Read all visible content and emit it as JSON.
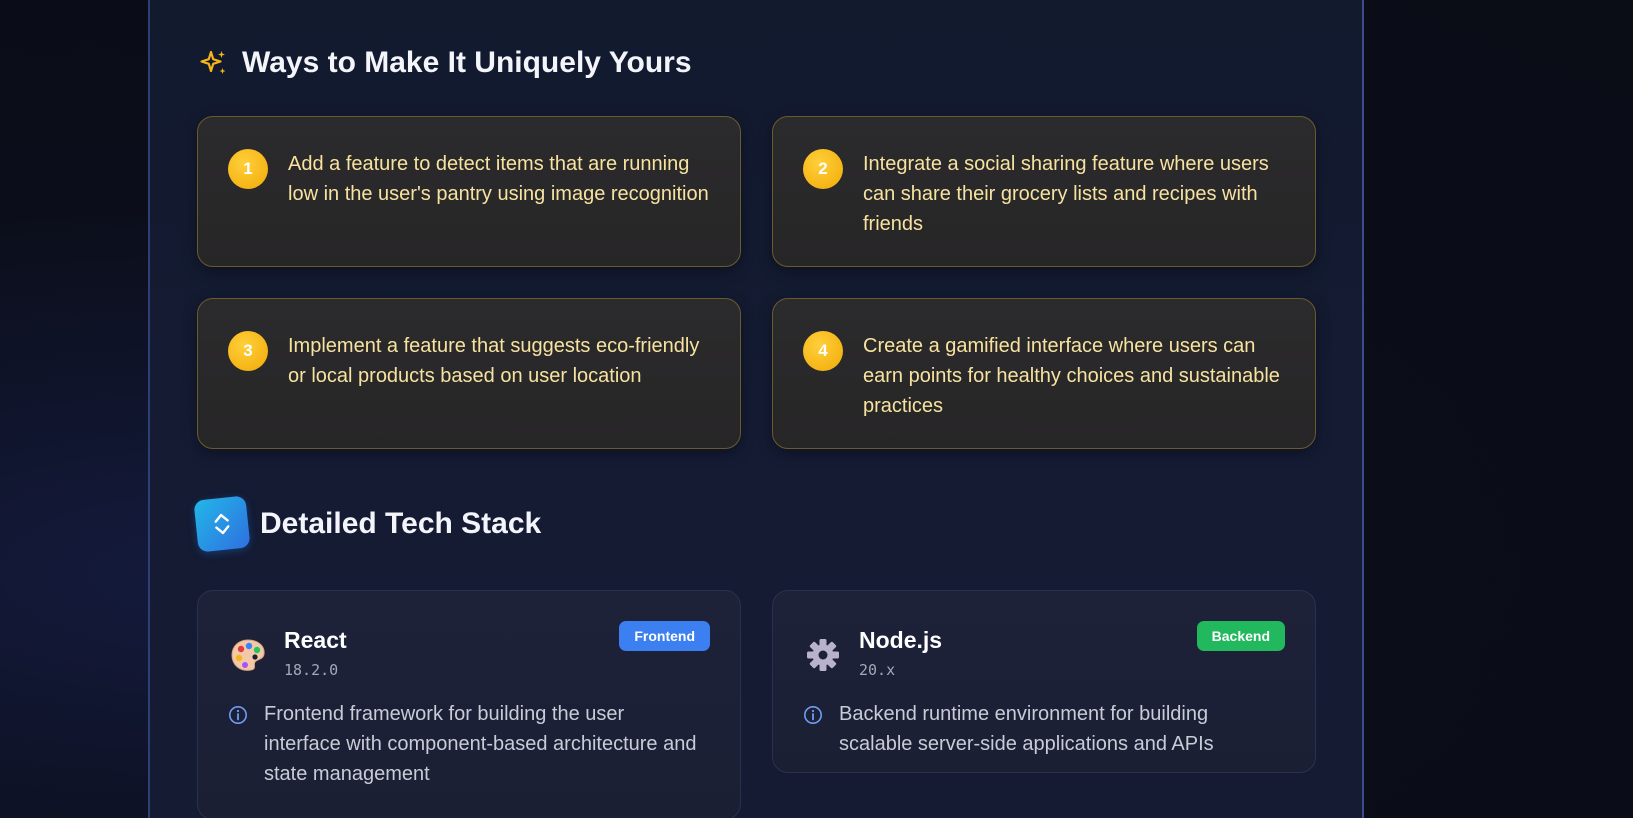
{
  "ways": {
    "title": "Ways to Make It Uniquely Yours",
    "icon": "sparkle-icon",
    "accent": "#f5b516",
    "ideas": [
      {
        "num": "1",
        "text": "Add a feature to detect items that are running low in the user's pantry using image recognition"
      },
      {
        "num": "2",
        "text": "Integrate a social sharing feature where users can share their grocery lists and recipes with friends"
      },
      {
        "num": "3",
        "text": "Implement a feature that suggests eco-friendly or local products based on user location"
      },
      {
        "num": "4",
        "text": "Create a gamified interface where users can earn points for healthy choices and sustainable practices"
      }
    ]
  },
  "tech": {
    "title": "Detailed Tech Stack",
    "icon": "code-icon",
    "items": [
      {
        "name": "React",
        "version": "18.2.0",
        "badge": "Frontend",
        "badge_color": "#3b7ff0",
        "icon": "palette-icon",
        "description": "Frontend framework for building the user interface with component-based architecture and state management"
      },
      {
        "name": "Node.js",
        "version": "20.x",
        "badge": "Backend",
        "badge_color": "#22b85e",
        "icon": "gear-icon",
        "description": "Backend runtime environment for building scalable server-side applications and APIs"
      }
    ]
  }
}
